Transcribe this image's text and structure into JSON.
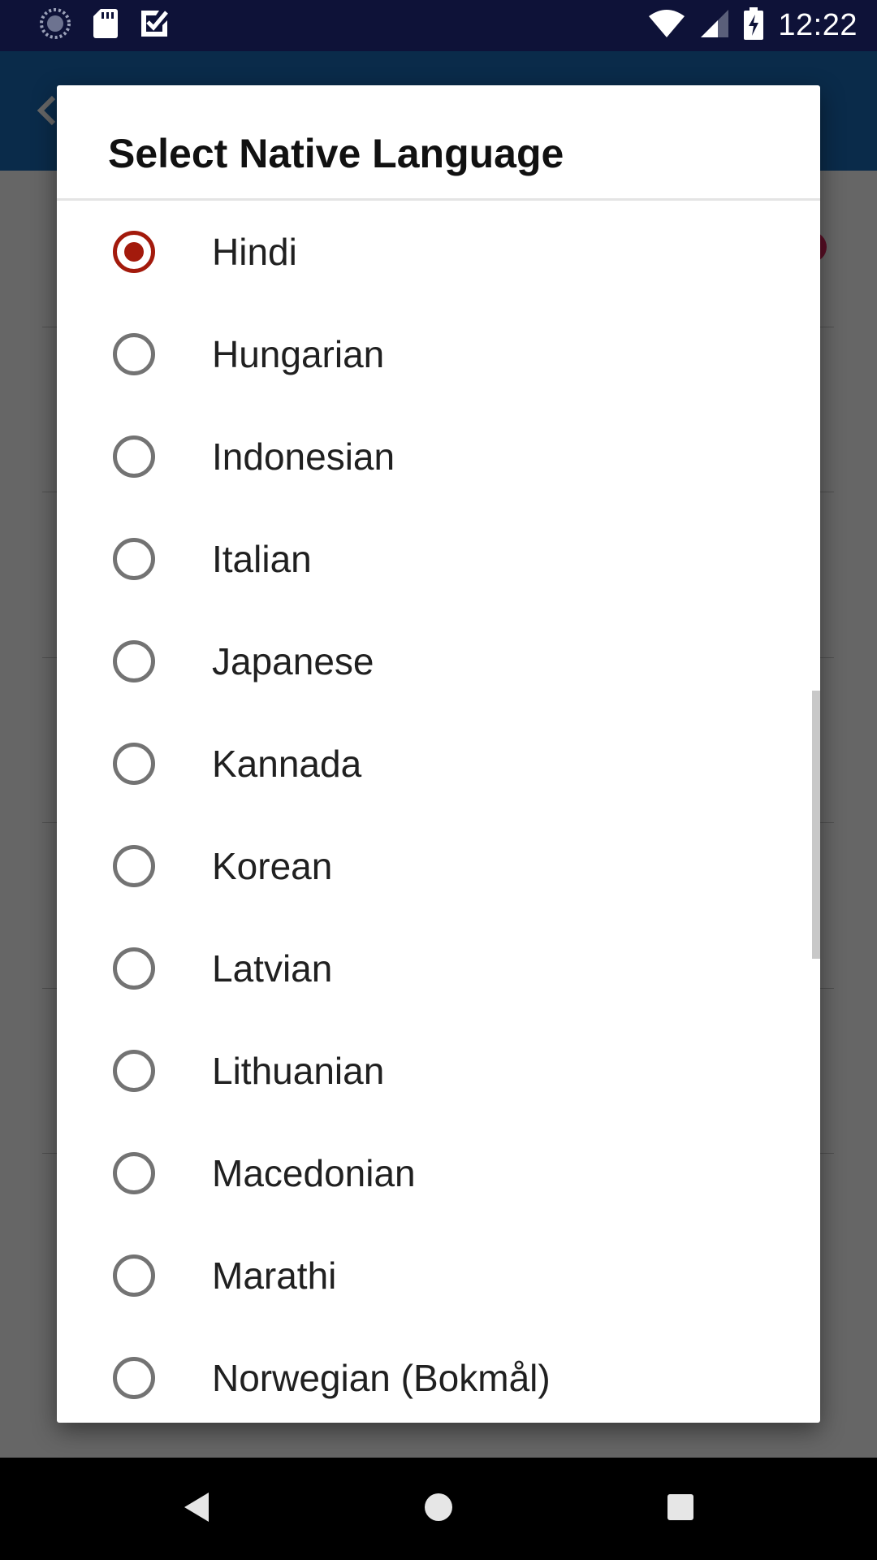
{
  "status_bar": {
    "time": "12:22",
    "left_icons": [
      "spinner-icon",
      "sd-card-icon",
      "checkmark-app-icon"
    ],
    "right_icons": [
      "wifi-icon",
      "cellular-signal-icon",
      "battery-charging-icon"
    ]
  },
  "dialog": {
    "title": "Select Native Language",
    "selected": "Hindi",
    "options": [
      {
        "label": "Hindi",
        "checked": true
      },
      {
        "label": "Hungarian",
        "checked": false
      },
      {
        "label": "Indonesian",
        "checked": false
      },
      {
        "label": "Italian",
        "checked": false
      },
      {
        "label": "Japanese",
        "checked": false
      },
      {
        "label": "Kannada",
        "checked": false
      },
      {
        "label": "Korean",
        "checked": false
      },
      {
        "label": "Latvian",
        "checked": false
      },
      {
        "label": "Lithuanian",
        "checked": false
      },
      {
        "label": "Macedonian",
        "checked": false
      },
      {
        "label": "Marathi",
        "checked": false
      },
      {
        "label": "Norwegian (Bokmål)",
        "checked": false
      }
    ]
  },
  "colors": {
    "status_bar": "#0e1238",
    "app_toolbar": "#1a6db8",
    "radio_checked": "#a31a0c",
    "radio_unchecked": "#737373"
  },
  "nav_bar": {
    "buttons": [
      "back-icon",
      "home-icon",
      "recents-icon"
    ]
  }
}
